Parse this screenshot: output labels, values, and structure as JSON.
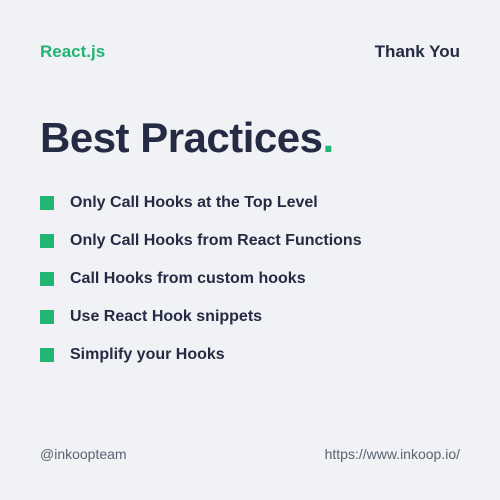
{
  "header": {
    "brand": "React.js",
    "thank_you": "Thank You"
  },
  "title": {
    "text": "Best Practices",
    "dot": "."
  },
  "list": {
    "items": [
      "Only Call Hooks at the Top Level",
      "Only Call Hooks from React Functions",
      "Call Hooks from custom hooks",
      "Use React Hook snippets",
      "Simplify your Hooks"
    ]
  },
  "footer": {
    "handle": "@inkoopteam",
    "url": "https://www.inkoop.io/"
  },
  "colors": {
    "accent": "#21b573",
    "text": "#252b42",
    "background": "#f0f2f5"
  }
}
